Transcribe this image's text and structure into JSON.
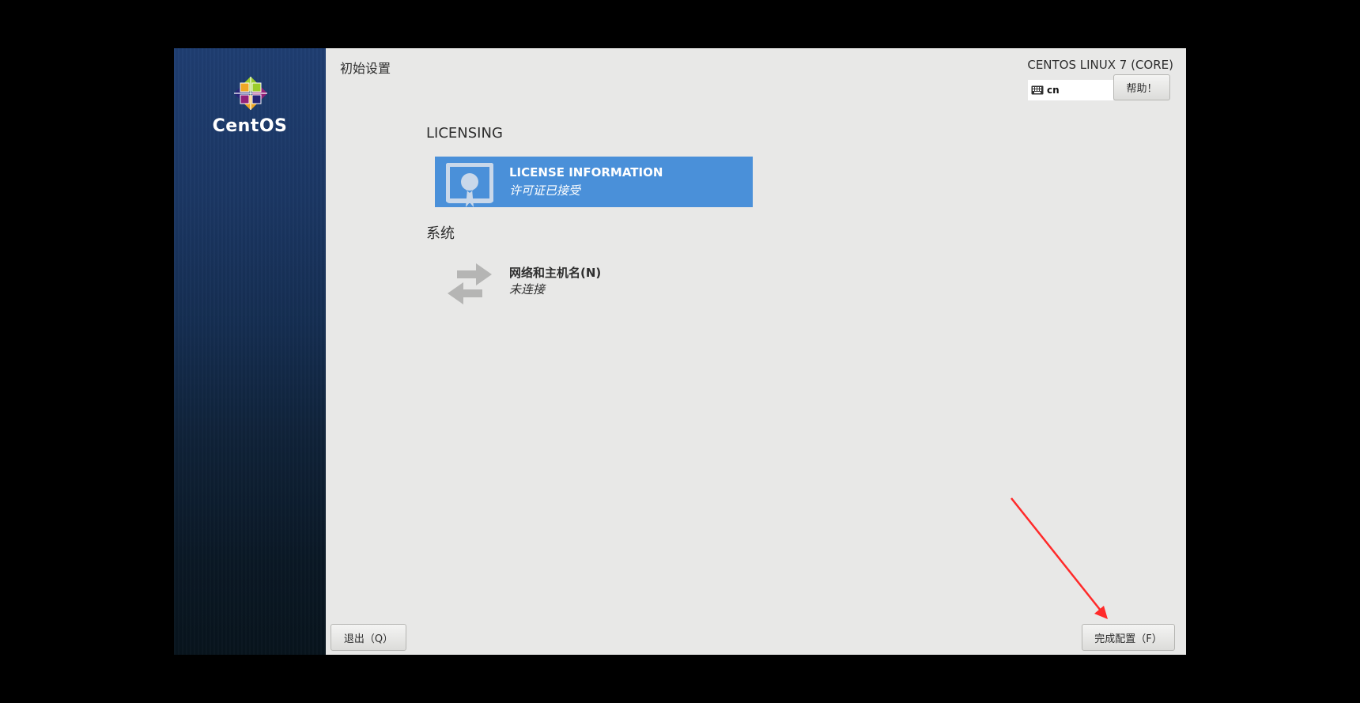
{
  "window": {
    "logo_text": "CentOS",
    "page_title": "初始设置",
    "distro": "CENTOS LINUX 7 (CORE)",
    "keyboard_layout": "cn",
    "help_label": "帮助！"
  },
  "sections": [
    {
      "heading": "LICENSING",
      "spokes": [
        {
          "title": "LICENSE INFORMATION",
          "status": "许可证已接受",
          "icon": "certificate-icon"
        }
      ]
    },
    {
      "heading": "系统",
      "spokes": [
        {
          "title": "网络和主机名(N)",
          "status": "未连接",
          "icon": "network-arrows-icon"
        }
      ]
    }
  ],
  "footer": {
    "quit_label": "退出（Q）",
    "finish_label": "完成配置（F）"
  },
  "colors": {
    "selected_spoke": "#4a90d9",
    "annotation_arrow": "#ff2a2a"
  }
}
